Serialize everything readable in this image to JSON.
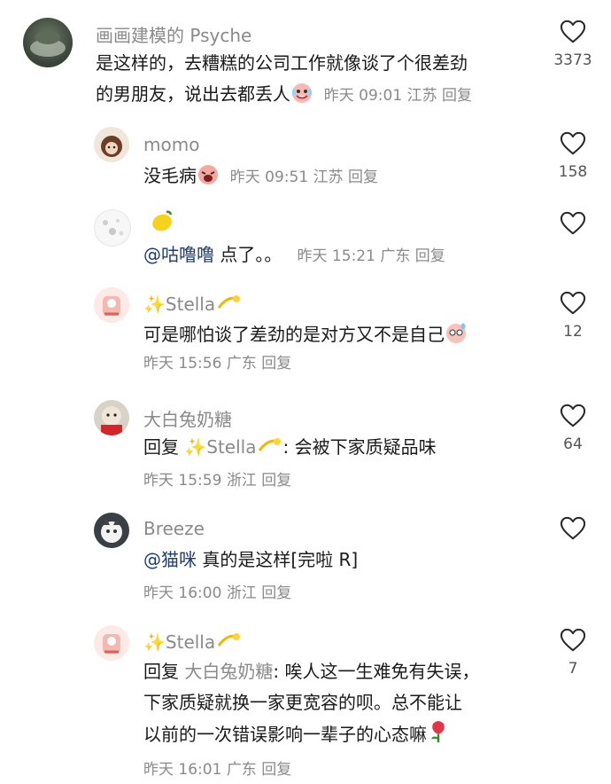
{
  "comments": [
    {
      "author": "画画建模的 Psyche",
      "line1": "是这样的，去糟糕的公司工作就像谈了个很差劲",
      "line2": "的男朋友，说出去都丢人",
      "time": "昨天 09:01",
      "location": "江苏",
      "reply_label": "回复",
      "likes": "3373"
    },
    {
      "author": "momo",
      "text": "没毛病",
      "time": "昨天 09:51",
      "location": "江苏",
      "reply_label": "回复",
      "likes": "158"
    },
    {
      "author": "",
      "mention": "@咕噜噜",
      "text": " 点了。。",
      "time": "昨天 15:21",
      "location": "广东",
      "reply_label": "回复",
      "likes": ""
    },
    {
      "author": "✨Stella",
      "text": "可是哪怕谈了差劲的是对方又不是自己",
      "time": "昨天 15:56",
      "location": "广东",
      "reply_label": "回复",
      "likes": "12"
    },
    {
      "author": "大白兔奶糖",
      "reply_prefix": "回复",
      "reply_to": "✨Stella",
      "text": ": 会被下家质疑品味",
      "time": "昨天 15:59",
      "location": "浙江",
      "reply_label": "回复",
      "likes": "64"
    },
    {
      "author": "Breeze",
      "mention": "@猫咪",
      "text": " 真的是这样[完啦 R]",
      "time": "昨天 16:00",
      "location": "浙江",
      "reply_label": "回复",
      "likes": ""
    },
    {
      "author": "✨Stella",
      "reply_prefix": "回复",
      "reply_to": "大白兔奶糖",
      "line1": ": 唉人这一生难免有失误，",
      "line2": "下家质疑就换一家更宽容的呗。总不能让",
      "line3": "以前的一次错误影响一辈子的心态嘛",
      "time": "昨天 16:01",
      "location": "广东",
      "reply_label": "回复",
      "likes": "7"
    }
  ],
  "icons": {
    "like": "heart-outline-icon"
  },
  "colors": {
    "mention": "#1f3b73",
    "meta": "#8a8a8a"
  }
}
